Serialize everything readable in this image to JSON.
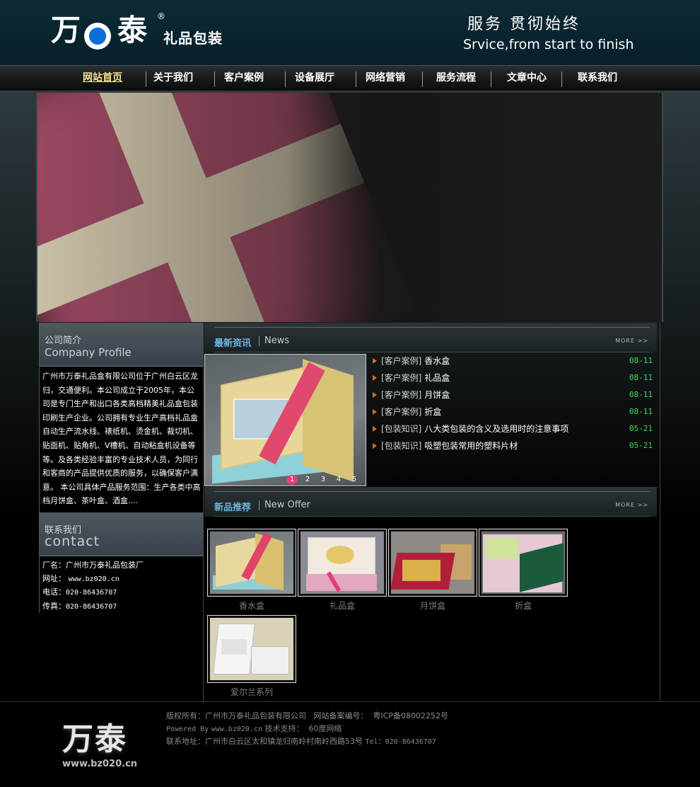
{
  "header": {
    "logo_char_1": "万",
    "logo_char_2": "泰",
    "logo_reg": "®",
    "logo_sub": "礼品包装",
    "slogan_cn": "服务 贯彻始终",
    "slogan_en": "Srvice,from start to finish"
  },
  "nav": {
    "items": [
      {
        "label": "网站首页",
        "active": true
      },
      {
        "label": "关于我们"
      },
      {
        "label": "客户案例"
      },
      {
        "label": "设备展厅"
      },
      {
        "label": "网络营销"
      },
      {
        "label": "服务流程"
      },
      {
        "label": "文章中心"
      },
      {
        "label": "联系我们"
      }
    ]
  },
  "profile": {
    "title_cn": "公司简介",
    "title_en": "Company Profile",
    "text": "广州市万泰礼品盒有限公司位于广州白云区龙归，交通便利。本公司成立于2005年，本公司是专门生产和出口各类高档精美礼品盒包装印刷生产企业。公司拥有专业生产高档礼品盒自动生产流水线、裱纸机、烫金机、裁切机、贴面机、贴角机、V槽机、自动粘盒机设备等等。及各类经验丰富的专业技术人员，为同行和客商的产品提供优质的服务，以确保客户满意。 本公司具体产品服务范围：生产各类中高档月饼盒、茶叶盒、酒盒...."
  },
  "contact": {
    "title_cn": "联系我们",
    "title_en": "contact",
    "factory_label": "厂名：",
    "factory": "广州市万泰礼品包装厂",
    "site_label": "网址：",
    "site": "www.bz020.cn",
    "phone_label": "电话：",
    "phone": "020-86436707",
    "fax_label": "传真：",
    "fax": "020-86436707"
  },
  "news": {
    "title_cn": "最新资讯",
    "title_en": "News",
    "more": "MORE >>",
    "pager": [
      "1",
      "2",
      "3",
      "4",
      "5"
    ],
    "items": [
      {
        "cat": "[客户案例]",
        "title": "香水盒",
        "date": "08-11"
      },
      {
        "cat": "[客户案例]",
        "title": "礼品盒",
        "date": "08-11"
      },
      {
        "cat": "[客户案例]",
        "title": "月饼盒",
        "date": "08-11"
      },
      {
        "cat": "[客户案例]",
        "title": "折盒",
        "date": "08-11"
      },
      {
        "cat": "[包装知识]",
        "title": "八大类包装的含义及选用时的注意事项",
        "date": "05-21"
      },
      {
        "cat": "[包装知识]",
        "title": "吸塑包装常用的塑料片材",
        "date": "05-21"
      }
    ]
  },
  "offer": {
    "title_cn": "新品推荐",
    "title_en": "New Offer",
    "more": "MORE >>",
    "products": [
      {
        "name": "香水盒"
      },
      {
        "name": "礼品盒"
      },
      {
        "name": "月饼盒"
      },
      {
        "name": "折盒"
      },
      {
        "name": "爱尔兰系列"
      }
    ]
  },
  "footer": {
    "logo": "万泰",
    "url": "www.bz020.cn",
    "copyright_label": "版权所有：",
    "company": "广州市万泰礼品包装有限公司",
    "icp_label": "网站备案编号：",
    "icp": "粤ICP备08002252号",
    "powered_label": "Powered By",
    "powered": "www.bz020.cn",
    "support_label": "技术支持：",
    "support": "60度网络",
    "address_label": "联系地址：",
    "address": "广州市白云区太和镇龙归南岭村南岭西路53号",
    "tel_label": "Tel：",
    "tel": "020-86436707"
  },
  "colors": {
    "header_bg": "#0d2a34",
    "nav_active": "#f5e38a",
    "news_title": "#6cb5e0",
    "news_date": "#3ddc53",
    "news_arrow": "#e06a16",
    "pager_active": "#e0407a"
  }
}
